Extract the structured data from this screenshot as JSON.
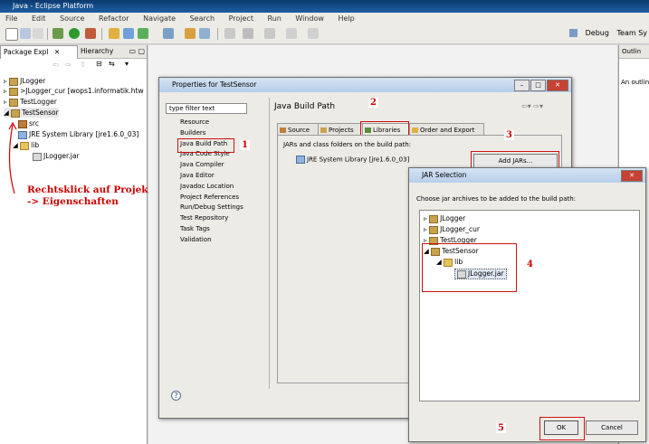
{
  "window": {
    "title": "Java - Eclipse Platform"
  },
  "menu": [
    "File",
    "Edit",
    "Source",
    "Refactor",
    "Navigate",
    "Search",
    "Project",
    "Run",
    "Window",
    "Help"
  ],
  "perspectives": {
    "debug": "Debug",
    "team": "Team Sy"
  },
  "package_explorer": {
    "tab_label": "Package Expl",
    "tab_hierarchy": "Hierarchy",
    "items": [
      {
        "label": "JLogger"
      },
      {
        "label": ">JLogger_cur  [wops1.informatik.htw"
      },
      {
        "label": "TestLogger"
      },
      {
        "label": "TestSensor"
      },
      {
        "label": "src"
      },
      {
        "label": "JRE System Library [jre1.6.0_03]"
      },
      {
        "label": "lib"
      },
      {
        "label": "JLogger.jar"
      }
    ]
  },
  "annotation": {
    "line1": "Rechtsklick auf Projekt",
    "line2": "-> Eigenschaften"
  },
  "outline": {
    "tab": "Outlin",
    "text": "An outline"
  },
  "properties": {
    "title": "Properties for TestSensor",
    "filter_placeholder": "type filter text",
    "nav": [
      "Resource",
      "Builders",
      "Java Build Path",
      "Java Code Style",
      "Java Compiler",
      "Java Editor",
      "Javadoc Location",
      "Project References",
      "Run/Debug Settings",
      "Test Repository",
      "Task Tags",
      "Validation"
    ],
    "section_title": "Java Build Path",
    "tabs": [
      "Source",
      "Projects",
      "Libraries",
      "Order and Export"
    ],
    "libs_desc": "JARs and class folders on the build path:",
    "jre_entry": "JRE System Library [jre1.6.0_03]",
    "add_jars": "Add JARs...",
    "help": "?"
  },
  "jar_selection": {
    "title": "JAR Selection",
    "desc": "Choose jar archives to be added to the build path:",
    "tree": [
      "JLogger",
      "JLogger_cur",
      "TestLogger",
      "TestSensor",
      "lib",
      "JLogger.jar"
    ],
    "ok": "OK",
    "cancel": "Cancel"
  },
  "steps": [
    "1",
    "2",
    "3",
    "4",
    "5"
  ],
  "colors": {
    "highlight": "#d01010",
    "annotation": "#cc0000",
    "titlebar": "#0b3a6e"
  }
}
